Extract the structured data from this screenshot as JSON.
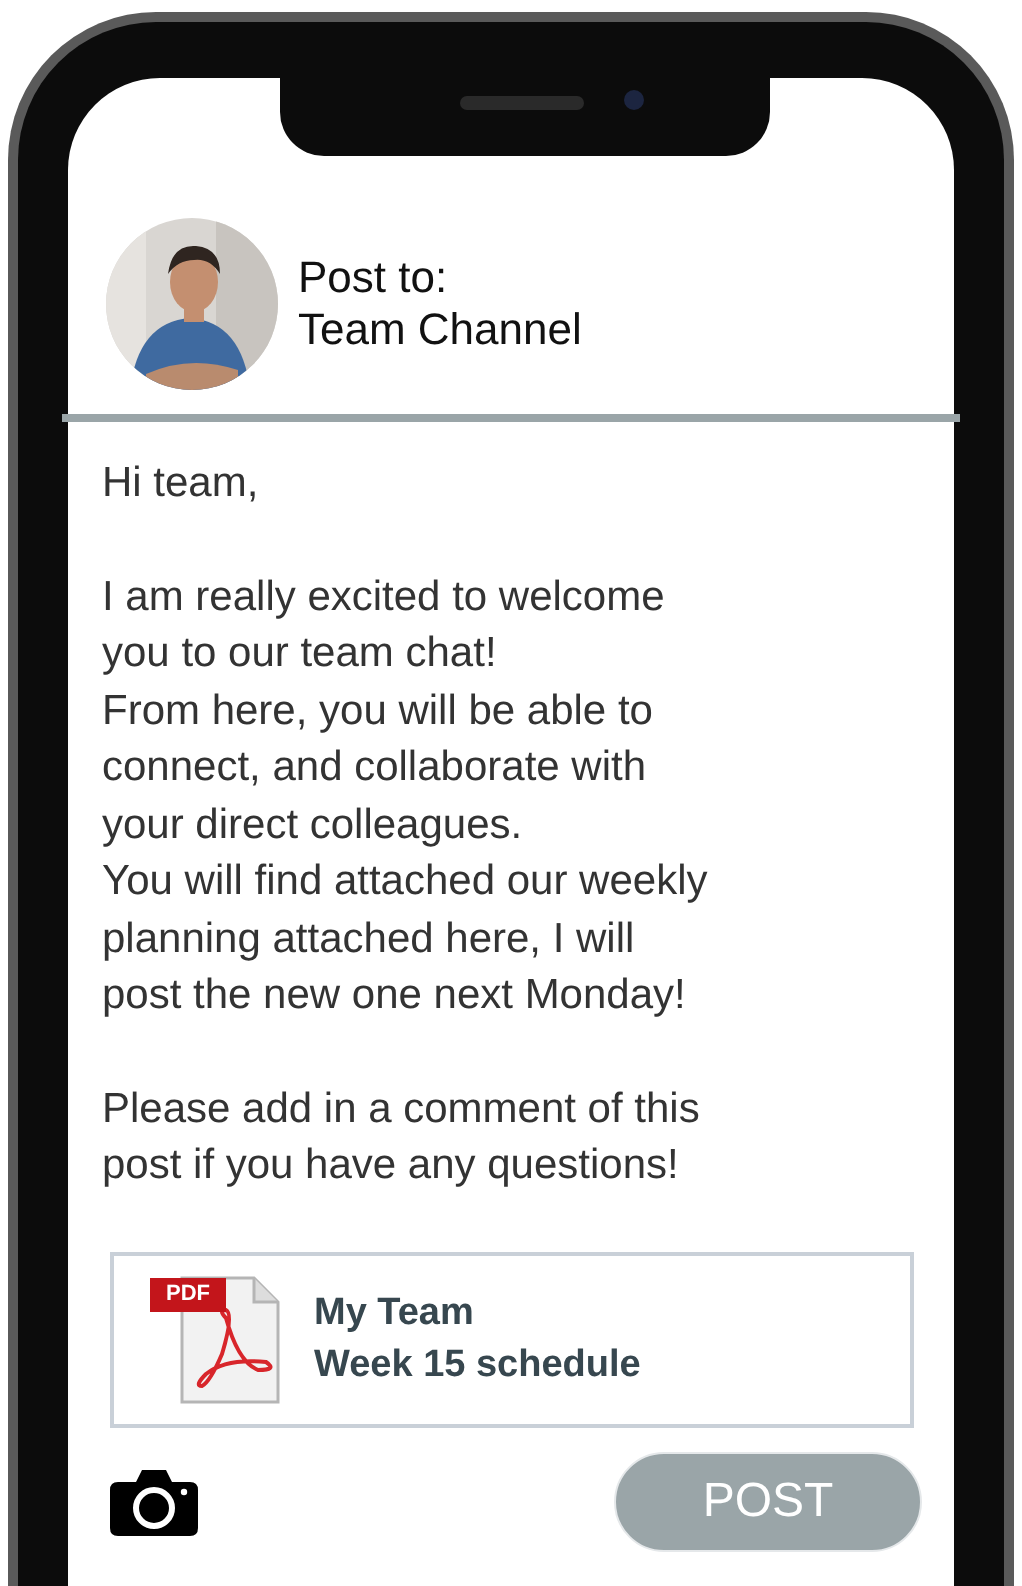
{
  "header": {
    "label": "Post to:",
    "channel": "Team Channel"
  },
  "message": [
    [
      "Hi team,"
    ],
    [
      "I am really excited to welcome",
      "you to our team chat!",
      "From here, you will be able to",
      "connect, and collaborate with",
      "your direct colleagues.",
      "You will find attached our weekly",
      "planning attached here, I will",
      "post the new one next Monday!"
    ],
    [
      "Please add in a comment of this",
      "post if you have any questions!"
    ]
  ],
  "attachment": {
    "badge": "PDF",
    "title": "My Team",
    "subtitle": "Week 15 schedule"
  },
  "post_button": {
    "label": "POST",
    "disabled": true
  }
}
